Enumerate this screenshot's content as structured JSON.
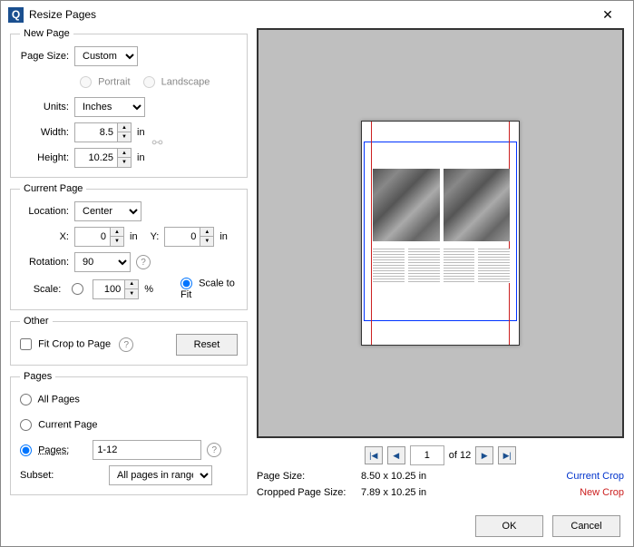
{
  "title": "Resize Pages",
  "newPage": {
    "legend": "New Page",
    "pageSizeLabel": "Page Size:",
    "pageSizeValue": "Custom",
    "portrait": "Portrait",
    "landscape": "Landscape",
    "unitsLabel": "Units:",
    "unitsValue": "Inches",
    "widthLabel": "Width:",
    "widthValue": "8.5",
    "heightLabel": "Height:",
    "heightValue": "10.25",
    "inUnit": "in"
  },
  "currentPage": {
    "legend": "Current Page",
    "locationLabel": "Location:",
    "locationValue": "Center",
    "xLabel": "X:",
    "xValue": "0",
    "yLabel": "Y:",
    "yValue": "0",
    "inUnit": "in",
    "rotationLabel": "Rotation:",
    "rotationValue": "90",
    "scaleLabel": "Scale:",
    "scalePercent": "100",
    "percentSign": "%",
    "scaleToFit": "Scale to Fit"
  },
  "other": {
    "legend": "Other",
    "fitCrop": "Fit Crop to Page",
    "reset": "Reset"
  },
  "pages": {
    "legend": "Pages",
    "allPages": "All Pages",
    "currentPage": "Current Page",
    "pagesLabel": "Pages:",
    "pagesRange": "1-12",
    "subsetLabel": "Subset:",
    "subsetValue": "All pages in range"
  },
  "pager": {
    "current": "1",
    "total": "of 12"
  },
  "info": {
    "pageSizeLabel": "Page Size:",
    "pageSizeValue": "8.50 x 10.25 in",
    "croppedLabel": "Cropped Page Size:",
    "croppedValue": "7.89 x 10.25 in",
    "currentCrop": "Current Crop",
    "newCrop": "New Crop"
  },
  "footer": {
    "ok": "OK",
    "cancel": "Cancel"
  }
}
